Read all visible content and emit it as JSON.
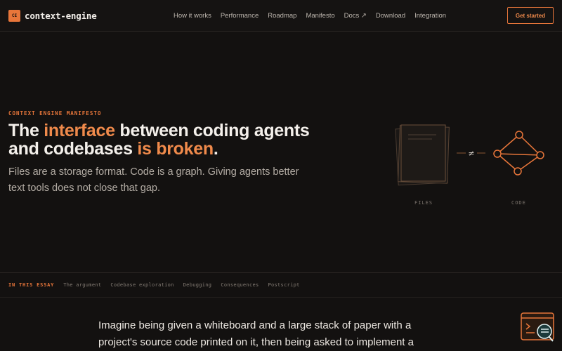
{
  "nav": {
    "logo_text": "CE",
    "brand": "context-engine",
    "links": [
      "How it works",
      "Performance",
      "Roadmap",
      "Manifesto",
      "Docs ↗",
      "Download",
      "Integration"
    ],
    "cta": "Get started"
  },
  "hero": {
    "kicker": "CONTEXT ENGINE MANIFESTO",
    "title_part1": "The ",
    "title_accent1": "interface",
    "title_part2": " between coding agents and codebases ",
    "title_accent2": "is broken",
    "title_part3": ".",
    "subtitle": "Files are a storage format. Code is a graph. Giving agents better text tools does not close that gap."
  },
  "illustration": {
    "files_label": "FILES",
    "code_label": "CODE",
    "neq_symbol": "≠"
  },
  "toc": {
    "label": "IN THIS ESSAY",
    "items": [
      "The argument",
      "Codebase exploration",
      "Debugging",
      "Consequences",
      "Postscript"
    ]
  },
  "essay": {
    "intro": "Imagine being given a whiteboard and a large stack of paper with a project's source code printed on it, then being asked to implement a"
  },
  "colors": {
    "accent": "#e8763a",
    "background": "#131110",
    "text": "#f4f0eb"
  },
  "icons": {
    "help_widget": "chat-help-icon"
  }
}
